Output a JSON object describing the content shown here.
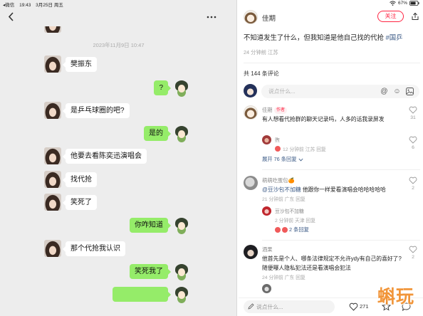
{
  "status_bar": {
    "back_app": "◂微信",
    "time": "19:43",
    "date": "3月25日 周五",
    "battery": "67%"
  },
  "chat": {
    "timestamp": "2023年11月9日 10:47",
    "messages": [
      {
        "side": "left",
        "text": "樊振东"
      },
      {
        "side": "right",
        "text": "?"
      },
      {
        "side": "left",
        "text": "是乒乓球圈的吧?"
      },
      {
        "side": "right",
        "text": "是的"
      },
      {
        "side": "left",
        "text": "他要去看陈奕迅演唱会"
      },
      {
        "side": "left",
        "text": "找代抢"
      },
      {
        "side": "left",
        "text": "笑死了"
      },
      {
        "side": "right",
        "text": "你咋知道"
      },
      {
        "side": "left",
        "text": "那个代抢我认识"
      },
      {
        "side": "right",
        "text": "笑死我了"
      }
    ],
    "colors": {
      "background": "#ededed",
      "bubble_self": "#95ec69",
      "bubble_other": "#ffffff"
    }
  },
  "post": {
    "author": "佳期",
    "follow_label": "关注",
    "text": "不知道发生了什么，但我知道是他自己找的代抢 ",
    "hashtag": "#国乒",
    "meta": "24 分钟前 江苏",
    "comment_count": "共 144 条评论",
    "comment_placeholder": "说点什么..."
  },
  "comments": [
    {
      "name": "佳期",
      "badge": "作者",
      "text": "有人想看代抢群的聊天记录吗，人多的话我录屏发",
      "likes": "31",
      "reply": {
        "name": "煦",
        "meta": "12 分钟前 江苏 回复",
        "likes": "6"
      },
      "expand": "展开 76 条回复"
    },
    {
      "name": "萌萌吃蛋包🍊",
      "mention": "@豆沙包不加糖",
      "text": " 他跟你一样爱看演唱会哈哈哈哈哈",
      "likes": "2",
      "meta": "21 分钟前 广东 回复",
      "reply": {
        "name": "豆沙包不加糖",
        "meta": "2 分钟前 天津 回复"
      },
      "expand": "2 条回复"
    },
    {
      "name": "酒果",
      "text": "他首先是个人、哪条法律规定不允许ydy有自己的喜好了? 随便曝人隐私犯法还是看演唱会犯法",
      "likes": "2",
      "meta": "24 分钟前 广东 回复"
    }
  ],
  "bottom_bar": {
    "placeholder": "说点什么...",
    "likes": "271"
  },
  "watermark": "蝌玩",
  "icons": [
    "back-icon",
    "more-icon",
    "wifi-icon",
    "battery-icon",
    "share-icon",
    "at-icon",
    "emoji-icon",
    "image-icon",
    "heart-icon",
    "chevron-down-icon",
    "pencil-icon",
    "star-icon",
    "comment-icon"
  ],
  "colors": {
    "accent": "#ff2442",
    "link": "#3b5a86",
    "muted": "#a8a8a8"
  }
}
